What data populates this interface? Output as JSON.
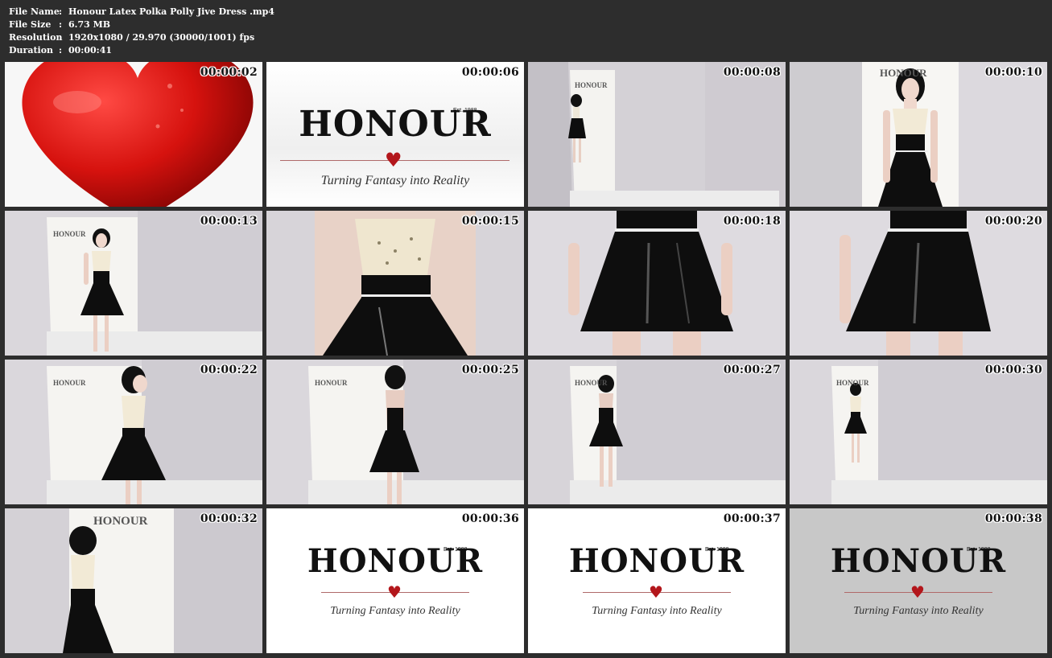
{
  "info": {
    "file_name_label": "File Name",
    "file_name": "Honour Latex Polka Polly Jive Dress .mp4",
    "file_size_label": "File Size",
    "file_size": "6.73 MB",
    "resolution_label": "Resolution",
    "resolution": "1920x1080 / 29.970 (30000/1001) fps",
    "duration_label": "Duration",
    "duration": "00:00:41",
    "separator": ":"
  },
  "brand": {
    "logo": "HONOUR",
    "established": "Est. 1988",
    "tagline": "Turning Fantasy into Reality",
    "wall_sign": "HONOUR",
    "heart_glyph": "♥"
  },
  "colors": {
    "background": "#2d2d2d",
    "heart_red": "#b3161b",
    "latex_black": "#0e0e0e",
    "studio_wall": "#d9d6dc"
  },
  "thumbnails": [
    {
      "timestamp": "00:00:02",
      "scene": "red heart close-up"
    },
    {
      "timestamp": "00:00:06",
      "scene": "honour logo"
    },
    {
      "timestamp": "00:00:08",
      "scene": "model entering studio"
    },
    {
      "timestamp": "00:00:10",
      "scene": "model front view"
    },
    {
      "timestamp": "00:00:13",
      "scene": "model posing hand on hip"
    },
    {
      "timestamp": "00:00:15",
      "scene": "close-up bodice"
    },
    {
      "timestamp": "00:00:18",
      "scene": "close-up skirt"
    },
    {
      "timestamp": "00:00:20",
      "scene": "close-up skirt side"
    },
    {
      "timestamp": "00:00:22",
      "scene": "model side view"
    },
    {
      "timestamp": "00:00:25",
      "scene": "model back turn"
    },
    {
      "timestamp": "00:00:27",
      "scene": "model walking away"
    },
    {
      "timestamp": "00:00:30",
      "scene": "model far view"
    },
    {
      "timestamp": "00:00:32",
      "scene": "model exiting"
    },
    {
      "timestamp": "00:00:36",
      "scene": "honour logo"
    },
    {
      "timestamp": "00:00:37",
      "scene": "honour logo"
    },
    {
      "timestamp": "00:00:38",
      "scene": "honour logo grey"
    }
  ]
}
